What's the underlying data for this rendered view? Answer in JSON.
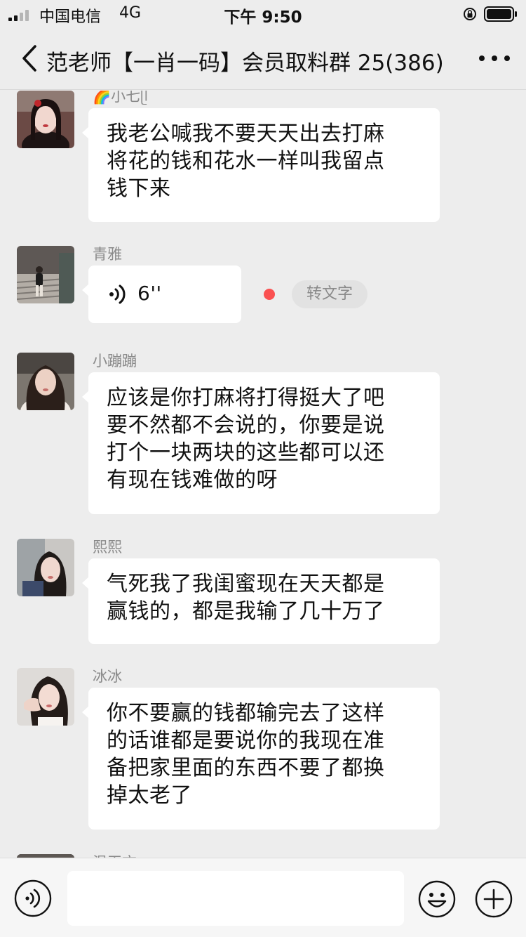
{
  "status_bar": {
    "carrier": "中国电信",
    "network": "4G",
    "time": "下午 9:50"
  },
  "header": {
    "title": "范老师【一肖一码】会员取料群 25(386)"
  },
  "messages": [
    {
      "sender": "🌈小七ᥫ",
      "type": "text",
      "text": "我老公喊我不要天天出去打麻\n将花的钱和花水一样叫我留点\n钱下来"
    },
    {
      "sender": "青雅",
      "type": "voice",
      "duration": "6''",
      "transcribe_label": "转文字"
    },
    {
      "sender": "小蹦蹦",
      "type": "text",
      "text": "应该是你打麻将打得挺大了吧\n要不然都不会说的，你要是说\n打个一块两块的这些都可以还\n有现在钱难做的呀"
    },
    {
      "sender": "熙熙",
      "type": "text",
      "text": "气死我了我闺蜜现在天天都是\n赢钱的，都是我输了几十万了"
    },
    {
      "sender": "冰冰",
      "type": "text",
      "text": "你不要赢的钱都输完去了这样\n的话谁都是要说你的我现在准\n备把家里面的东西不要了都换\n掉太老了"
    },
    {
      "sender": "温玉衣",
      "type": "text",
      "text": ""
    }
  ],
  "input_bar": {
    "placeholder": ""
  },
  "colors": {
    "background": "#ededed",
    "bubble": "#ffffff",
    "unread_dot": "#fa5151",
    "secondary_text": "#8a8a8a"
  },
  "icons": [
    "signal-icon",
    "lock-icon",
    "battery-icon",
    "back-icon",
    "more-icon",
    "voice-wave-icon",
    "voice-toggle-icon",
    "emoji-icon",
    "plus-icon"
  ]
}
